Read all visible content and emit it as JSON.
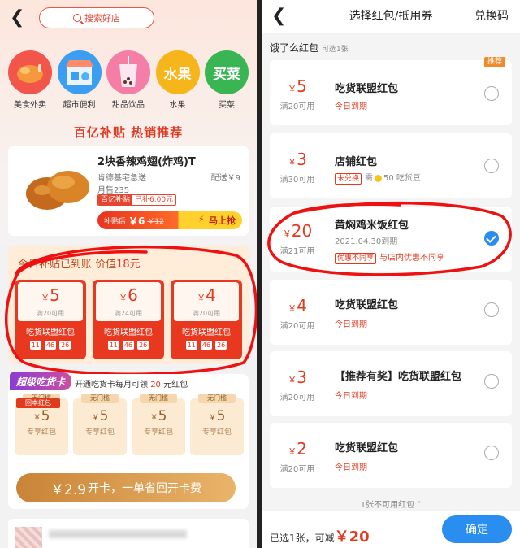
{
  "left": {
    "search_label": "搜索好店",
    "categories": [
      {
        "label": "美食外卖",
        "icon": "chicken-icon",
        "color": "#f2554a"
      },
      {
        "label": "超市便利",
        "icon": "store-icon",
        "color": "#3c9ef0"
      },
      {
        "label": "甜品饮品",
        "icon": "bubble-tea-icon",
        "color": "#f47ea6"
      },
      {
        "label": "水果",
        "icon": "fruit-icon",
        "color": "#f6b51a",
        "icon_text": "水果"
      },
      {
        "label": "买菜",
        "icon": "vegetable-icon",
        "color": "#39b554",
        "icon_text": "买菜"
      }
    ],
    "promo_title": "百亿补贴 热销推荐",
    "product": {
      "name": "2块香辣鸡翅(炸鸡)T",
      "shop": "肯德基宅急送",
      "delivery": "配送￥9",
      "sales": "月售235",
      "tag_a": "百亿补贴",
      "tag_b": "已补6.00元",
      "after_label": "补贴后",
      "price": "￥6",
      "orig_price": "￥12",
      "buy_label": "马上抢"
    },
    "coupon_header": {
      "text": "今日补贴已到账  价值",
      "value": "18元"
    },
    "red_coupons": [
      {
        "symbol": "￥",
        "amount": "5",
        "cond": "满20可用",
        "name": "吃货联盟红包",
        "t1": "11",
        "t2": "46",
        "t3": "26"
      },
      {
        "symbol": "￥",
        "amount": "6",
        "cond": "满24可用",
        "name": "吃货联盟红包",
        "t1": "11",
        "t2": "46",
        "t3": "26"
      },
      {
        "symbol": "￥",
        "amount": "4",
        "cond": "满20可用",
        "name": "吃货联盟红包",
        "t1": "11",
        "t2": "46",
        "t3": "26"
      }
    ],
    "vip": {
      "badge": "超级吃货卡",
      "text_a": "开通吃货卡每月可领",
      "text_amt": "20",
      "text_b": "元红包",
      "huiben": "回本红包",
      "coupons": [
        {
          "tag": "无门槛",
          "symbol": "￥",
          "amount": "5",
          "name": "专享红包"
        },
        {
          "tag": "无门槛",
          "symbol": "￥",
          "amount": "5",
          "name": "专享红包"
        },
        {
          "tag": "无门槛",
          "symbol": "￥",
          "amount": "5",
          "name": "专享红包"
        },
        {
          "tag": "无门槛",
          "symbol": "￥",
          "amount": "5",
          "name": "专享红包"
        }
      ],
      "button_price": "￥2.9",
      "button_text": "开卡，一单省回开卡费"
    }
  },
  "right": {
    "title": "选择红包/抵用券",
    "redeem": "兑换码",
    "section": "饿了么红包",
    "section_hint": "可选1张",
    "cards": [
      {
        "symbol": "￥",
        "amount": "5",
        "cond": "满20可用",
        "name": "吃货联盟红包",
        "sub": "今日到期",
        "rec": "推荐"
      },
      {
        "symbol": "￥",
        "amount": "3",
        "cond": "满30可用",
        "name": "店铺红包",
        "chip": "未兑换",
        "sub_a": "需",
        "sub_b": "50 吃货豆"
      },
      {
        "symbol": "￥",
        "amount": "20",
        "cond": "满21可用",
        "name": "黄焖鸡米饭红包",
        "sub": "2021.04.30到期",
        "chip": "优惠不同享",
        "sub_c": "与店内优惠不同享"
      },
      {
        "symbol": "￥",
        "amount": "4",
        "cond": "满20可用",
        "name": "吃货联盟红包",
        "sub": "今日到期"
      },
      {
        "symbol": "￥",
        "amount": "3",
        "cond": "满20可用",
        "name": "【推荐有奖】吃货联盟红包",
        "sub": "今日到期"
      },
      {
        "symbol": "￥",
        "amount": "2",
        "cond": "满20可用",
        "name": "吃货联盟红包",
        "sub": "今日到期"
      }
    ],
    "unusable": "1张不可用红包 ˅",
    "footer": {
      "text_a": "已选1张，可减",
      "amount": "￥20",
      "confirm": "确定"
    }
  }
}
